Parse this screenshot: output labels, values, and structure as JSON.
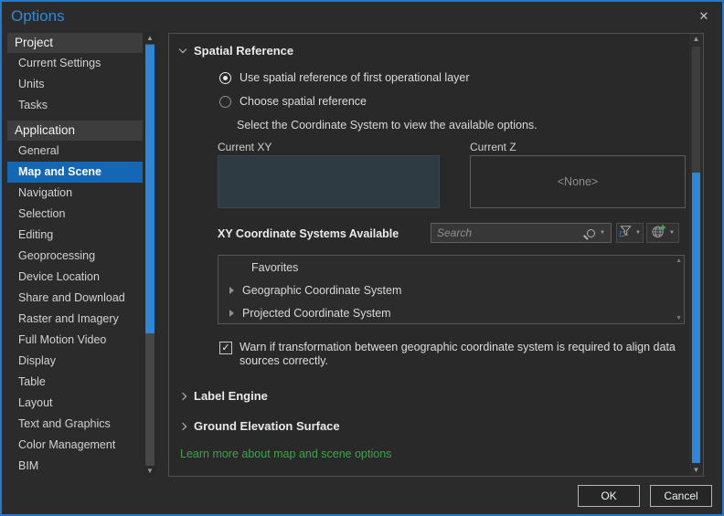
{
  "window": {
    "title": "Options"
  },
  "icons": {
    "close": "✕",
    "arrow_up": "▲",
    "arrow_down": "▼",
    "caret_down": "▼",
    "check": "✓"
  },
  "colors": {
    "accent_blue": "#2e86d6",
    "selection_blue": "#1467b4",
    "title_blue": "#2e8ada",
    "link_green": "#3da44a",
    "current_xy_fill": "#2e3b42",
    "dialog_border": "#2779c8"
  },
  "sidebar": {
    "groups": [
      {
        "label": "Project",
        "items": [
          {
            "label": "Current Settings"
          },
          {
            "label": "Units"
          },
          {
            "label": "Tasks"
          }
        ]
      },
      {
        "label": "Application",
        "items": [
          {
            "label": "General"
          },
          {
            "label": "Map and Scene",
            "selected": true
          },
          {
            "label": "Navigation"
          },
          {
            "label": "Selection"
          },
          {
            "label": "Editing"
          },
          {
            "label": "Geoprocessing"
          },
          {
            "label": "Device Location"
          },
          {
            "label": "Share and Download"
          },
          {
            "label": "Raster and Imagery"
          },
          {
            "label": "Full Motion Video"
          },
          {
            "label": "Display"
          },
          {
            "label": "Table"
          },
          {
            "label": "Layout"
          },
          {
            "label": "Text and Graphics"
          },
          {
            "label": "Color Management"
          },
          {
            "label": "BIM"
          }
        ]
      }
    ]
  },
  "content": {
    "spatial_reference": {
      "title": "Spatial Reference",
      "options": [
        {
          "label": "Use spatial reference of first operational layer",
          "selected": true
        },
        {
          "label": "Choose spatial reference",
          "selected": false
        }
      ],
      "hint": "Select the Coordinate System to view the available options.",
      "current_xy": {
        "label": "Current XY",
        "value": ""
      },
      "current_z": {
        "label": "Current Z",
        "value": "<None>"
      },
      "xy_available": {
        "label": "XY Coordinate Systems Available",
        "search": {
          "placeholder": "Search"
        },
        "list": [
          {
            "label": "Favorites",
            "expandable": false
          },
          {
            "label": "Geographic Coordinate System",
            "expandable": true
          },
          {
            "label": "Projected Coordinate System",
            "expandable": true
          }
        ]
      },
      "warn": {
        "checked": true,
        "label": "Warn if transformation between geographic coordinate system is required to align data sources correctly."
      }
    },
    "collapsed_sections": [
      {
        "label": "Label Engine"
      },
      {
        "label": "Ground Elevation Surface"
      }
    ],
    "learn_more": "Learn more about map and scene options"
  },
  "footer": {
    "ok_label": "OK",
    "cancel_label": "Cancel"
  }
}
